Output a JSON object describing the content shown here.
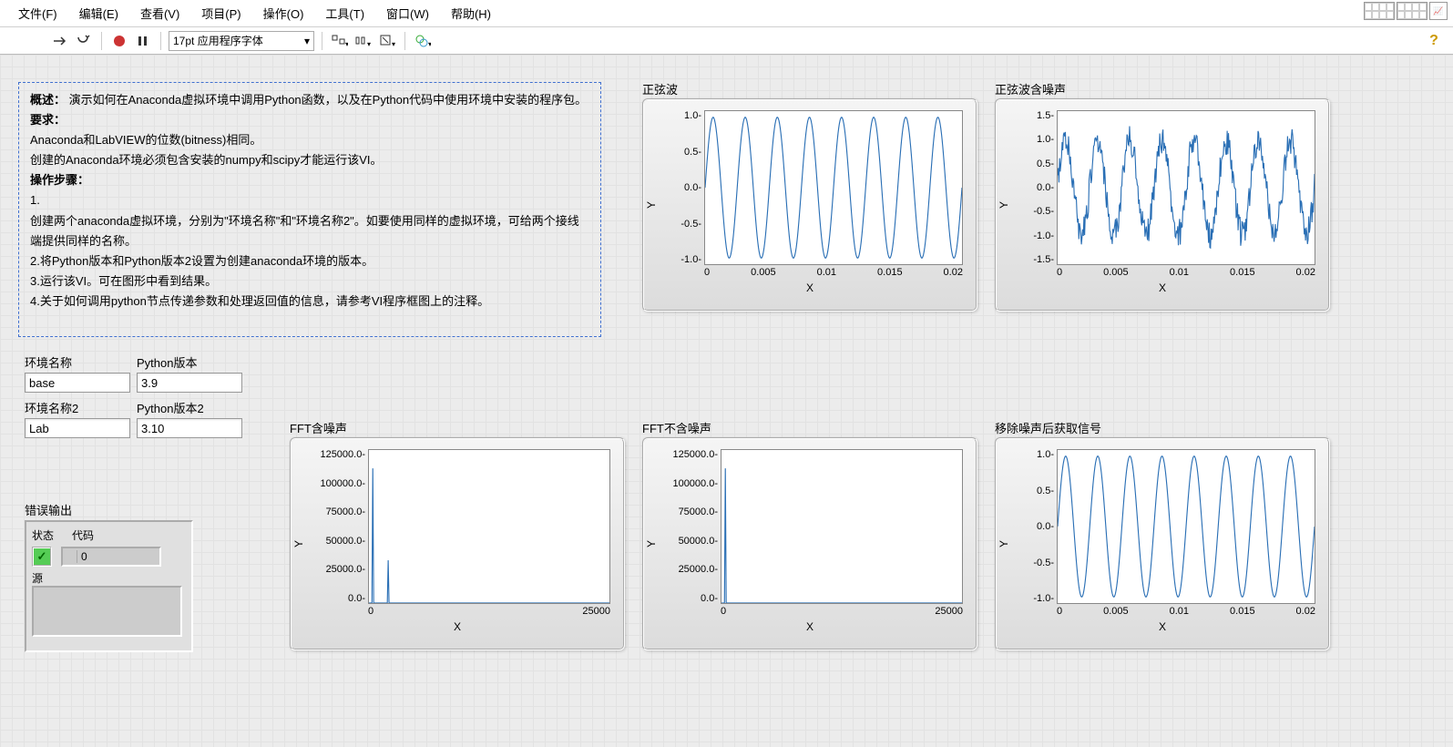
{
  "menu": {
    "items": [
      "文件(F)",
      "编辑(E)",
      "查看(V)",
      "项目(P)",
      "操作(O)",
      "工具(T)",
      "窗口(W)",
      "帮助(H)"
    ]
  },
  "toolbar": {
    "font": "17pt 应用程序字体"
  },
  "description": {
    "label_overview": "概述：",
    "overview": "演示如何在Anaconda虚拟环境中调用Python函数，以及在Python代码中使用环境中安装的程序包。",
    "label_req": "要求：",
    "req1": "Anaconda和LabVIEW的位数(bitness)相同。",
    "req2": "创建的Anaconda环境必须包含安装的numpy和scipy才能运行该VI。",
    "label_steps": "操作步骤：",
    "steps": [
      "1.",
      "创建两个anaconda虚拟环境，分别为\"环境名称\"和\"环境名称2\"。如要使用同样的虚拟环境，可给两个接线端提供同样的名称。",
      "2.将Python版本和Python版本2设置为创建anaconda环境的版本。",
      "3.运行该VI。可在图形中看到结果。",
      "4.关于如何调用python节点传递参数和处理返回值的信息，请参考VI程序框图上的注释。"
    ]
  },
  "controls": {
    "env1_label": "环境名称",
    "env1_value": "base",
    "py1_label": "Python版本",
    "py1_value": "3.9",
    "env2_label": "环境名称2",
    "env2_value": "Lab",
    "py2_label": "Python版本2",
    "py2_value": "3.10"
  },
  "error": {
    "title": "错误输出",
    "status_label": "状态",
    "code_label": "代码",
    "code_value": "0",
    "source_label": "源"
  },
  "graphs": {
    "g1": {
      "title": "正弦波",
      "xlabel": "X",
      "ylabel": "Y"
    },
    "g2": {
      "title": "正弦波含噪声",
      "xlabel": "X",
      "ylabel": "Y"
    },
    "g3": {
      "title": "FFT含噪声",
      "xlabel": "X",
      "ylabel": "Y"
    },
    "g4": {
      "title": "FFT不含噪声",
      "xlabel": "X",
      "ylabel": "Y"
    },
    "g5": {
      "title": "移除噪声后获取信号",
      "xlabel": "X",
      "ylabel": "Y"
    }
  },
  "chart_data": [
    {
      "id": "g1",
      "type": "line",
      "title": "正弦波",
      "xlabel": "X",
      "ylabel": "Y",
      "xlim": [
        0,
        0.02
      ],
      "ylim": [
        -1,
        1
      ],
      "xticks": [
        0,
        0.005,
        0.01,
        0.015,
        0.02
      ],
      "yticks": [
        -1.0,
        -0.5,
        0.0,
        0.5,
        1.0
      ],
      "description": "sine wave, amplitude 1, ~8 cycles over 0–0.02 (≈400 Hz)"
    },
    {
      "id": "g2",
      "type": "line",
      "title": "正弦波含噪声",
      "xlabel": "X",
      "ylabel": "Y",
      "xlim": [
        0,
        0.02
      ],
      "ylim": [
        -1.5,
        1.5
      ],
      "xticks": [
        0,
        0.005,
        0.01,
        0.015,
        0.02
      ],
      "yticks": [
        -1.5,
        -1.0,
        -0.5,
        0.0,
        0.5,
        1.0,
        1.5
      ],
      "description": "sine wave with added noise, peaks ≈ ±1.3"
    },
    {
      "id": "g3",
      "type": "line",
      "title": "FFT含噪声",
      "xlabel": "X",
      "ylabel": "Y",
      "xlim": [
        0,
        25000
      ],
      "ylim": [
        0,
        125000
      ],
      "xticks": [
        0,
        25000
      ],
      "yticks": [
        0,
        25000,
        50000,
        75000,
        100000,
        125000
      ],
      "description": "FFT magnitude, main peak ≈110000 near f≈400, secondary peak ≈35000 near f≈2000, rest ≈0"
    },
    {
      "id": "g4",
      "type": "line",
      "title": "FFT不含噪声",
      "xlabel": "X",
      "ylabel": "Y",
      "xlim": [
        0,
        25000
      ],
      "ylim": [
        0,
        125000
      ],
      "xticks": [
        0,
        25000
      ],
      "yticks": [
        0,
        25000,
        50000,
        75000,
        100000,
        125000
      ],
      "description": "FFT magnitude, single peak ≈110000 near f≈400, rest ≈0"
    },
    {
      "id": "g5",
      "type": "line",
      "title": "移除噪声后获取信号",
      "xlabel": "X",
      "ylabel": "Y",
      "xlim": [
        0,
        0.02
      ],
      "ylim": [
        -1,
        1
      ],
      "xticks": [
        0,
        0.005,
        0.01,
        0.015,
        0.02
      ],
      "yticks": [
        -1.0,
        -0.5,
        0.0,
        0.5,
        1.0
      ],
      "description": "recovered sine wave after noise removal, amplitude 1, ~8 cycles"
    }
  ]
}
